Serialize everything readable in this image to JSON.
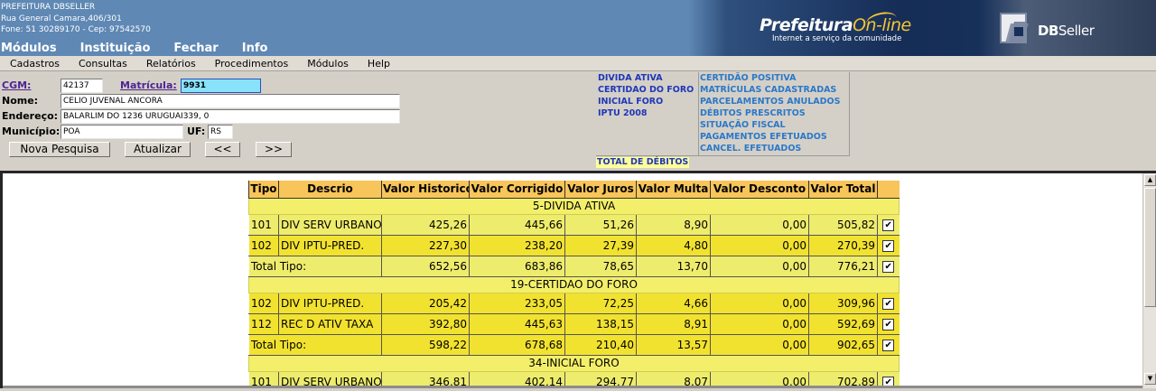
{
  "header": {
    "institution": "PREFEITURA DBSELLER",
    "address": "Rua General Camara,406/301",
    "contact": "Fone: 51 30289170  -  Cep: 97542570",
    "menu": [
      "Módulos",
      "Instituição",
      "Fechar",
      "Info"
    ],
    "logo_title_part1": "Prefeitura",
    "logo_title_part2": "On-line",
    "logo_tagline": "Internet a serviço da comunidade",
    "dbseller_logo_db": "DB",
    "dbseller_logo_seller": "Seller"
  },
  "menubar": [
    "Cadastros",
    "Consultas",
    "Relatórios",
    "Procedimentos",
    "Módulos",
    "Help"
  ],
  "form": {
    "cgm_label": "CGM:",
    "cgm_value": "42137",
    "matricula_label": "Matrícula:",
    "matricula_value": "9931",
    "nome_label": "Nome:",
    "nome_value": "CELIO JUVENAL ANCORA",
    "endereco_label": "Endereço:",
    "endereco_value": "BALARLIM DO 1236 URUGUAI339, 0",
    "municipio_label": "Município:",
    "municipio_value": "POA",
    "uf_label": "UF:",
    "uf_value": "RS",
    "buttons": {
      "nova_pesquisa": "Nova Pesquisa",
      "atualizar": "Atualizar",
      "prev": "<<",
      "next": ">>"
    }
  },
  "links": {
    "left": [
      "DIVIDA ATIVA",
      "CERTIDAO DO FORO",
      "INICIAL FORO",
      "IPTU 2008"
    ],
    "right": [
      "CERTIDÃO POSITIVA",
      "MATRÍCULAS CADASTRADAS",
      "PARCELAMENTOS ANULADOS",
      "DÉBITOS PRESCRITOS",
      "SITUAÇÃO FISCAL",
      "PAGAMENTOS EFETUADOS",
      "CANCEL. EFETUADOS"
    ],
    "total": "TOTAL DE DÉBITOS"
  },
  "table": {
    "headers": [
      "Tipo",
      "Descrio",
      "Valor Historico",
      "Valor Corrigido",
      "Valor Juros",
      "Valor Multa",
      "Valor Desconto",
      "Valor Total"
    ],
    "groups": [
      {
        "title": "5-DIVIDA ATIVA",
        "rows": [
          {
            "tipo": "101",
            "descricao": "DIV SERV URBANO",
            "historico": "425,26",
            "corrigido": "445,66",
            "juros": "51,26",
            "multa": "8,90",
            "desconto": "0,00",
            "total": "505,82"
          },
          {
            "tipo": "102",
            "descricao": "DIV IPTU-PRED.",
            "historico": "227,30",
            "corrigido": "238,20",
            "juros": "27,39",
            "multa": "4,80",
            "desconto": "0,00",
            "total": "270,39"
          }
        ],
        "subtotal": {
          "label": "Total Tipo:",
          "historico": "652,56",
          "corrigido": "683,86",
          "juros": "78,65",
          "multa": "13,70",
          "desconto": "0,00",
          "total": "776,21"
        }
      },
      {
        "title": "19-CERTIDAO DO FORO",
        "rows": [
          {
            "tipo": "102",
            "descricao": "DIV IPTU-PRED.",
            "historico": "205,42",
            "corrigido": "233,05",
            "juros": "72,25",
            "multa": "4,66",
            "desconto": "0,00",
            "total": "309,96"
          },
          {
            "tipo": "112",
            "descricao": "REC D ATIV TAXA",
            "historico": "392,80",
            "corrigido": "445,63",
            "juros": "138,15",
            "multa": "8,91",
            "desconto": "0,00",
            "total": "592,69"
          }
        ],
        "subtotal": {
          "label": "Total Tipo:",
          "historico": "598,22",
          "corrigido": "678,68",
          "juros": "210,40",
          "multa": "13,57",
          "desconto": "0,00",
          "total": "902,65"
        }
      },
      {
        "title": "34-INICIAL FORO",
        "rows": [
          {
            "tipo": "101",
            "descricao": "DIV SERV URBANO",
            "historico": "346,81",
            "corrigido": "402,14",
            "juros": "294,77",
            "multa": "8,07",
            "desconto": "0,00",
            "total": "702,89"
          }
        ]
      }
    ]
  },
  "colors": {
    "banner_blue": "#5f88b4",
    "header_orange": "#f8c55a",
    "row_yellow_light": "#eeec6c",
    "row_yellow_dark": "#f2e230",
    "group_yellow": "#f3ef6a",
    "highlight_input": "#88e2fb",
    "link_dark_blue": "#1f37b8",
    "link_light_blue": "#2b78c8"
  },
  "icons": {
    "checkbox": "checked-checkbox",
    "scroll_up": "up-arrow-icon",
    "scroll_down": "down-arrow-icon"
  }
}
